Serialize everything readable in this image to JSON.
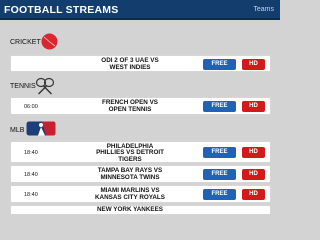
{
  "header": {
    "title": "FOOTBALL STREAMS",
    "nav_label": "Teams"
  },
  "sections": [
    {
      "name": "CRICKET",
      "icon": "cricket-ball-icon"
    },
    {
      "name": "TENNIS",
      "icon": "tennis-rackets-icon"
    },
    {
      "name": "MLB",
      "icon": "mlb-logo-icon"
    }
  ],
  "events": [
    {
      "time": "",
      "line1": "ODI 2 OF 3 UAE VS",
      "line2": "WEST INDIES",
      "free": "FREE",
      "hd": "HD"
    },
    {
      "time": "06:00",
      "line1": "FRENCH OPEN VS",
      "line2": "OPEN TENNIS",
      "free": "FREE",
      "hd": "HD"
    },
    {
      "time": "18:40",
      "line1": "PHILADELPHIA",
      "line2": "PHILLIES VS DETROIT",
      "line3": "TIGERS",
      "free": "FREE",
      "hd": "HD"
    },
    {
      "time": "18:40",
      "line1": "TAMPA BAY RAYS VS",
      "line2": "MINNESOTA TWINS",
      "free": "FREE",
      "hd": "HD"
    },
    {
      "time": "18:40",
      "line1": "MIAMI MARLINS VS",
      "line2": "KANSAS CITY ROYALS",
      "free": "FREE",
      "hd": "HD"
    },
    {
      "time": "",
      "line1": "NEW YORK YANKEES",
      "line2": "",
      "free": "",
      "hd": ""
    }
  ],
  "colors": {
    "header_bg": "#123d6d",
    "free_button": "#1e63b8",
    "hd_button": "#d11b1b",
    "page_bg": "#d3d3d3"
  }
}
